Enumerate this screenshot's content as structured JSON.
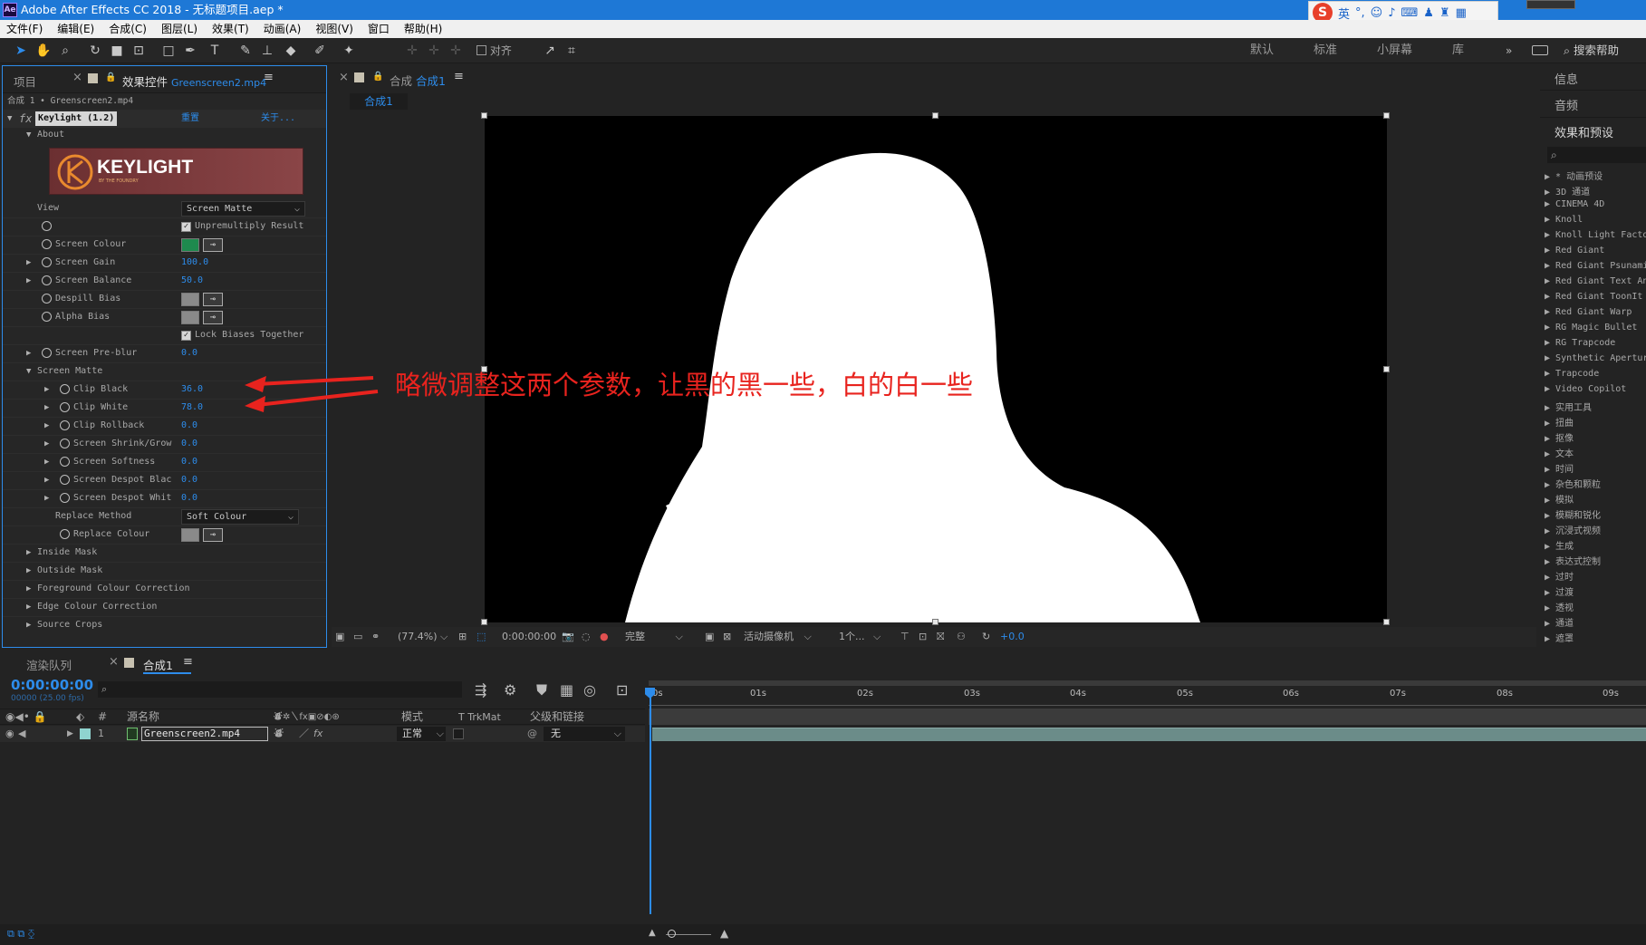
{
  "window": {
    "title": "Adobe After Effects CC 2018 - 无标题项目.aep *",
    "app_icon": "Ae"
  },
  "ime": {
    "label": "英"
  },
  "menu": [
    "文件(F)",
    "编辑(E)",
    "合成(C)",
    "图层(L)",
    "效果(T)",
    "动画(A)",
    "视图(V)",
    "窗口",
    "帮助(H)"
  ],
  "toolbar": {
    "align_label": "对齐",
    "workspaces": [
      "默认",
      "标准",
      "小屏幕",
      "库"
    ],
    "search_help": "搜索帮助"
  },
  "project_panel": {
    "tab": "项目"
  },
  "effect_controls": {
    "tab_prefix": "效果控件",
    "tab_file": "Greenscreen2.mp4",
    "breadcrumb": "合成 1 • Greenscreen2.mp4",
    "effect_name": "Keylight (1.2)",
    "reset": "重置",
    "about": "关于...",
    "about_section": "About",
    "logo_text": "KEYLIGHT",
    "logo_sub": "BY THE FOUNDRY",
    "view_label": "View",
    "view_value": "Screen Matte",
    "unpremultiply": "Unpremultiply Result",
    "screen_colour": "Screen Colour",
    "screen_colour_hex": "#1e8a4e",
    "screen_gain": {
      "label": "Screen Gain",
      "value": "100.0"
    },
    "screen_balance": {
      "label": "Screen Balance",
      "value": "50.0"
    },
    "despill_bias": "Despill Bias",
    "alpha_bias": "Alpha Bias",
    "lock_biases": "Lock Biases Together",
    "screen_preblur": {
      "label": "Screen Pre-blur",
      "value": "0.0"
    },
    "screen_matte": "Screen Matte",
    "clip_black": {
      "label": "Clip Black",
      "value": "36.0"
    },
    "clip_white": {
      "label": "Clip White",
      "value": "78.0"
    },
    "clip_rollback": {
      "label": "Clip Rollback",
      "value": "0.0"
    },
    "shrink_grow": {
      "label": "Screen Shrink/Grow",
      "value": "0.0"
    },
    "softness": {
      "label": "Screen Softness",
      "value": "0.0"
    },
    "despot_black": {
      "label": "Screen Despot Blac",
      "value": "0.0"
    },
    "despot_white": {
      "label": "Screen Despot Whit",
      "value": "0.0"
    },
    "replace_method": {
      "label": "Replace Method",
      "value": "Soft Colour"
    },
    "replace_colour": "Replace Colour",
    "inside_mask": "Inside Mask",
    "outside_mask": "Outside Mask",
    "fg_correction": "Foreground Colour Correction",
    "edge_correction": "Edge Colour Correction",
    "source_crops": "Source Crops"
  },
  "comp_panel": {
    "tab_prefix": "合成",
    "tab_name": "合成1",
    "subtab": "合成1",
    "annotation": "略微调整这两个参数，让黑的黑一些，白的白一些",
    "zoom": "(77.4%)",
    "timecode": "0:00:00:00",
    "quality": "完整",
    "camera": "活动摄像机",
    "views": "1个...",
    "exposure": "+0.0"
  },
  "right_panel": {
    "info": "信息",
    "audio": "音频",
    "effects_presets": "效果和预设",
    "search_icon": "⌕",
    "items": [
      "* 动画预设",
      "3D 通道",
      "CINEMA 4D",
      "Knoll",
      "Knoll Light Facto",
      "Red Giant",
      "Red Giant Psunami",
      "Red Giant Text An",
      "Red Giant ToonIt",
      "Red Giant Warp",
      "RG Magic Bullet",
      "RG Trapcode",
      "Synthetic Apertur",
      "Trapcode",
      "Video Copilot",
      "实用工具",
      "扭曲",
      "抠像",
      "文本",
      "时间",
      "杂色和颗粒",
      "模拟",
      "模糊和锐化",
      "沉浸式视频",
      "生成",
      "表达式控制",
      "过时",
      "过渡",
      "透视",
      "通道",
      "遮罩"
    ]
  },
  "timeline": {
    "render_queue": "渲染队列",
    "comp_tab": "合成1",
    "timecode": "0:00:00:00",
    "frame_info": "00000 (25.00 fps)",
    "headers": {
      "num": "#",
      "source": "源名称",
      "mode": "模式",
      "trk": "T  TrkMat",
      "parent": "父级和链接"
    },
    "layer": {
      "num": "1",
      "name": "Greenscreen2.mp4",
      "mode": "正常",
      "parent": "无"
    },
    "ruler": [
      "0s",
      "01s",
      "02s",
      "03s",
      "04s",
      "05s",
      "06s",
      "07s",
      "08s",
      "09s"
    ]
  }
}
